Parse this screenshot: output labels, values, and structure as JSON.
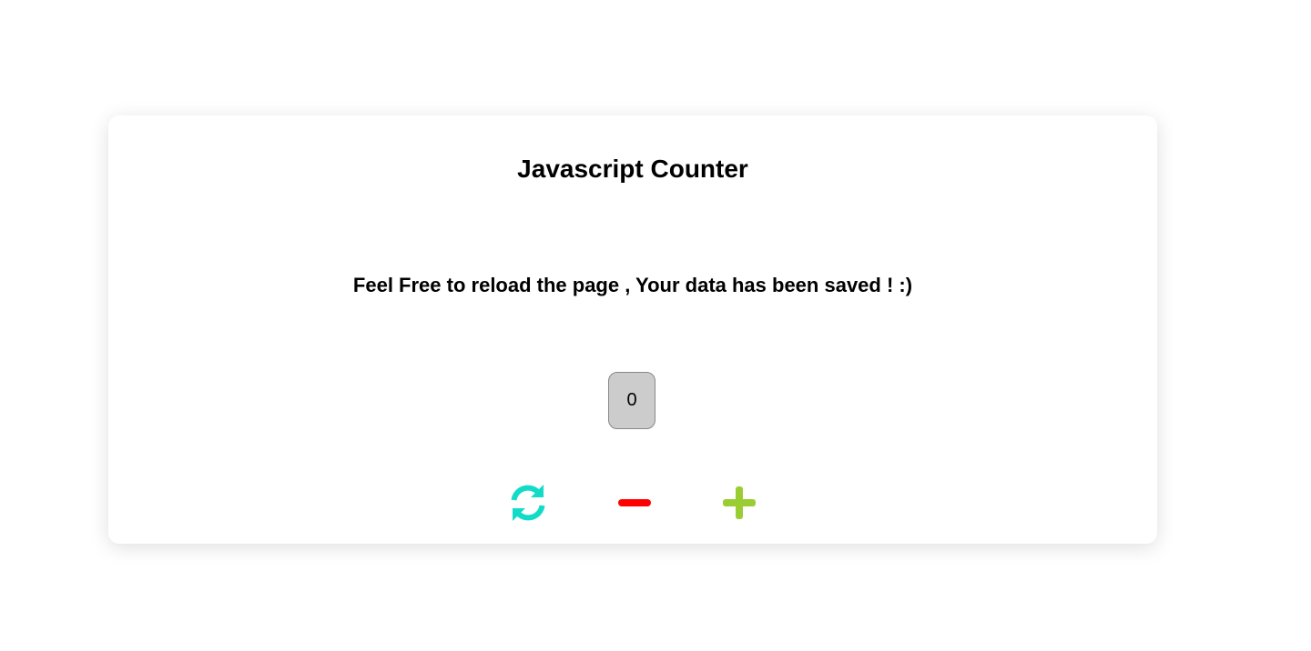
{
  "app": {
    "title": "Javascript Counter",
    "message": "Feel Free to reload the page , Your data has been saved ! :)"
  },
  "counter": {
    "value": "0"
  },
  "controls": {
    "reset_icon": "refresh-icon",
    "decrement_icon": "minus-icon",
    "increment_icon": "plus-icon"
  },
  "colors": {
    "reset": "#12dcc8",
    "decrement": "#ff0000",
    "increment": "#9acd32",
    "counter_bg": "#cccccc"
  }
}
